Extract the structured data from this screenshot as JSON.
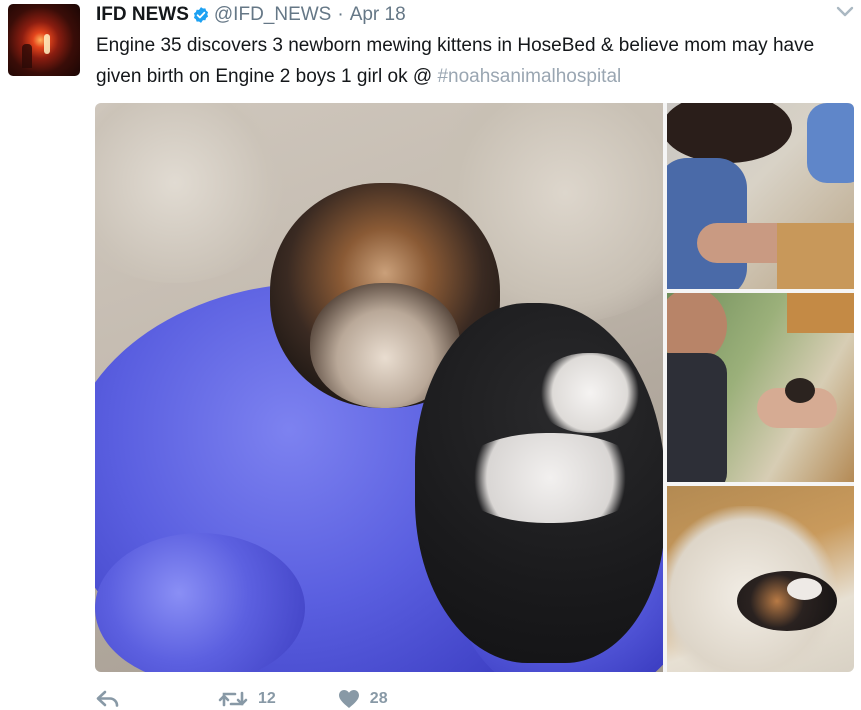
{
  "tweet": {
    "author_name": "IFD NEWS",
    "handle": "@IFD_NEWS",
    "separator": "·",
    "date": "Apr 18",
    "text_part1": "Engine 35 discovers 3 newborn mewing kittens in HoseBed & believe mom may have given birth on Engine 2 boys 1 girl ok @ ",
    "hashtag": "#noahsanimalhospital"
  },
  "actions": {
    "retweet_count": "12",
    "like_count": "28"
  },
  "icons": {
    "verified": "verified-badge-icon",
    "caret": "chevron-down-icon",
    "reply": "reply-icon",
    "retweet": "retweet-icon",
    "like": "heart-icon"
  },
  "colors": {
    "text": "#14171a",
    "muted": "#657786",
    "verified": "#1da1f2",
    "hashtag": "#9aa6b2",
    "action": "#8899a6"
  }
}
